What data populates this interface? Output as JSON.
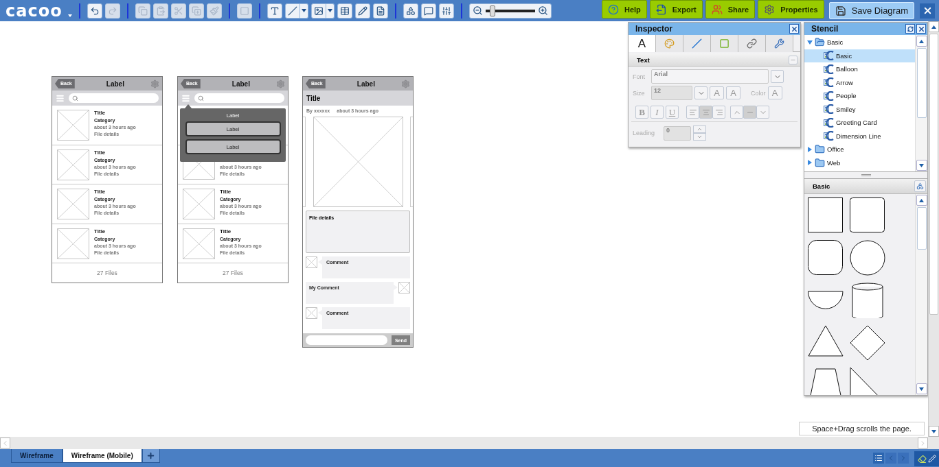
{
  "logo": "cacoo",
  "toolbar": [
    {
      "kind": "undo",
      "disabled": false
    },
    {
      "kind": "redo",
      "disabled": true
    },
    {
      "kind": "separator"
    },
    {
      "kind": "copy",
      "disabled": true
    },
    {
      "kind": "paste",
      "disabled": true
    },
    {
      "kind": "cut",
      "disabled": true
    },
    {
      "kind": "duplicate",
      "disabled": true
    },
    {
      "kind": "format",
      "disabled": true
    },
    {
      "kind": "separator"
    },
    {
      "kind": "group",
      "disabled": true
    },
    {
      "kind": "separator"
    },
    {
      "kind": "text",
      "disabled": false
    },
    {
      "kind": "line",
      "disabled": false,
      "dropdown": true
    },
    {
      "kind": "image",
      "disabled": false,
      "dropdown": true
    },
    {
      "kind": "table",
      "disabled": false
    },
    {
      "kind": "pencil",
      "disabled": false
    },
    {
      "kind": "form",
      "disabled": false
    },
    {
      "kind": "separator"
    },
    {
      "kind": "shapes",
      "disabled": false
    },
    {
      "kind": "comment",
      "disabled": false
    },
    {
      "kind": "sliders",
      "disabled": false
    },
    {
      "kind": "separator"
    },
    {
      "kind": "zoom",
      "level": 0.15
    }
  ],
  "header_buttons": [
    {
      "kind": "help",
      "label": "Help"
    },
    {
      "kind": "export",
      "label": "Export"
    },
    {
      "kind": "share",
      "label": "Share"
    },
    {
      "kind": "properties",
      "label": "Properties"
    }
  ],
  "save_button": "Save Diagram",
  "mockups": [
    {
      "kind": "list",
      "back": "Back",
      "title": "Label",
      "rows": [
        {
          "title": "Title",
          "category": "Category",
          "time": "about 3 hours ago",
          "details": "File details"
        },
        {
          "title": "Title",
          "category": "Category",
          "time": "about 3 hours ago",
          "details": "File details"
        },
        {
          "title": "Title",
          "category": "Category",
          "time": "about 3 hours ago",
          "details": "File details"
        },
        {
          "title": "Title",
          "category": "Category",
          "time": "about 3 hours ago",
          "details": "File details"
        }
      ],
      "footer": "27 Files"
    },
    {
      "kind": "list",
      "back": "Back",
      "title": "Label",
      "rows": [
        {},
        {
          "time": "about 3 hours ago",
          "details": "File details"
        },
        {
          "title": "Title",
          "category": "Category",
          "time": "about 3 hours ago",
          "details": "File details"
        },
        {
          "title": "Title",
          "category": "Category",
          "time": "about 3 hours ago",
          "details": "File details"
        }
      ],
      "footer": "27 Files",
      "popover": {
        "title": "Label",
        "buttons": [
          "Label",
          "Label"
        ]
      }
    },
    {
      "kind": "detail",
      "back": "Back",
      "title": "Label",
      "heading": "Title",
      "author": "By xxxxxx",
      "time": "about 3 hours ago",
      "details": "File details",
      "comments": [
        {
          "text": "Comment",
          "mine": false
        },
        {
          "text": "My Comment",
          "mine": true
        },
        {
          "text": "Comment",
          "mine": false
        }
      ],
      "send": "Send"
    }
  ],
  "inspector": {
    "title": "Inspector",
    "tabs": [
      {
        "kind": "text",
        "label": "A",
        "selected": true
      },
      {
        "kind": "fill",
        "selected": false
      },
      {
        "kind": "line",
        "selected": false
      },
      {
        "kind": "shadow",
        "selected": false
      },
      {
        "kind": "link",
        "selected": false
      },
      {
        "kind": "tools",
        "selected": false
      }
    ],
    "section": "Text",
    "font_label": "Font",
    "font_value": "Arial",
    "size_label": "Size",
    "size_value": "12",
    "grow": "A",
    "shrink": "A",
    "color_label": "Color",
    "color_glyph": "A",
    "styles": [
      "B",
      "I",
      "U"
    ],
    "align": [
      {
        "kind": "left",
        "selected": false
      },
      {
        "kind": "center",
        "selected": true
      },
      {
        "kind": "right",
        "selected": false
      }
    ],
    "valign": [
      {
        "kind": "top",
        "selected": false
      },
      {
        "kind": "middle",
        "selected": true
      },
      {
        "kind": "bottom",
        "selected": false
      }
    ],
    "leading_label": "Leading",
    "leading_value": "0"
  },
  "stencil": {
    "title": "Stencil",
    "tree": [
      {
        "label": "Basic",
        "expanded": true,
        "children": [
          {
            "label": "Basic",
            "selected": true
          },
          {
            "label": "Balloon",
            "selected": false
          },
          {
            "label": "Arrow",
            "selected": false
          },
          {
            "label": "People",
            "selected": false
          },
          {
            "label": "Smiley",
            "selected": false
          },
          {
            "label": "Greeting Card",
            "selected": false
          },
          {
            "label": "Dimension Line",
            "selected": false
          }
        ]
      },
      {
        "label": "Office",
        "expanded": false
      },
      {
        "label": "Web",
        "expanded": false
      }
    ],
    "palette_title": "Basic",
    "shapes": [
      {
        "kind": "square"
      },
      {
        "kind": "rounded-square"
      },
      {
        "kind": "soft-square"
      },
      {
        "kind": "circle"
      },
      {
        "kind": "half-circle"
      },
      {
        "kind": "cylinder"
      },
      {
        "kind": "triangle"
      },
      {
        "kind": "diamond"
      },
      {
        "kind": "trapezoid"
      },
      {
        "kind": "right-triangle"
      }
    ]
  },
  "hint": "Space+Drag scrolls the page.",
  "page_tabs": [
    {
      "label": "Wireframe",
      "selected": false
    },
    {
      "label": "Wireframe (Mobile)",
      "selected": true
    }
  ]
}
